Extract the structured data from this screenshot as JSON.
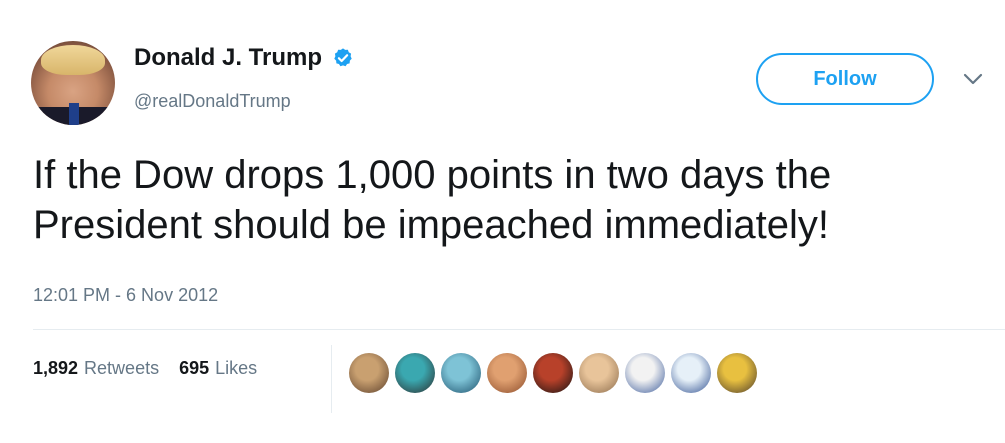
{
  "tweet": {
    "author_name": "Donald J. Trump",
    "author_handle": "@realDonaldTrump",
    "verified": true,
    "follow_label": "Follow",
    "text": "If the Dow drops 1,000 points in two days the\nPresident should be impeached immediately!",
    "timestamp": "12:01 PM - 6 Nov 2012",
    "retweets_count": "1,892",
    "retweets_label": "Retweets",
    "likes_count": "695",
    "likes_label": "Likes"
  },
  "icons": {
    "verified": "verified-badge-icon",
    "menu": "chevron-down-icon"
  },
  "colors": {
    "accent": "#1da1f2",
    "text": "#14171a",
    "muted": "#657786",
    "divider": "#e6ecf0"
  },
  "likers": [
    {
      "label": "liker-avatar-1",
      "color_a": "#c9a070",
      "color_b": "#5a3e2a"
    },
    {
      "label": "liker-avatar-2",
      "color_a": "#3aa8b0",
      "color_b": "#2b2b2b"
    },
    {
      "label": "liker-avatar-3",
      "color_a": "#7ec3d6",
      "color_b": "#1b4f6a"
    },
    {
      "label": "liker-avatar-4",
      "color_a": "#e0a070",
      "color_b": "#8a4b2a"
    },
    {
      "label": "liker-avatar-5",
      "color_a": "#b8412a",
      "color_b": "#111111"
    },
    {
      "label": "liker-avatar-6",
      "color_a": "#e8c49a",
      "color_b": "#8a6a4a"
    },
    {
      "label": "liker-avatar-7",
      "color_a": "#f2f2f2",
      "color_b": "#3a5a9a"
    },
    {
      "label": "liker-avatar-8",
      "color_a": "#e6f0f8",
      "color_b": "#2f4f8f"
    },
    {
      "label": "liker-avatar-9",
      "color_a": "#e8c040",
      "color_b": "#4a3a2a"
    }
  ]
}
